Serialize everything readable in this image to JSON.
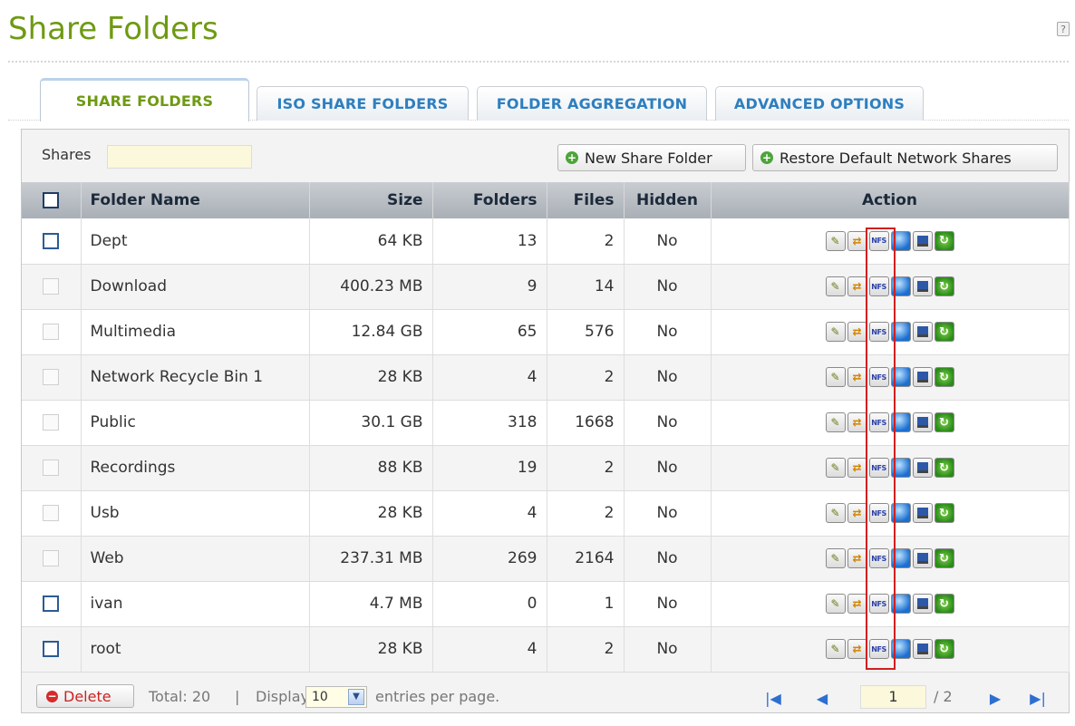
{
  "page": {
    "title": "Share Folders",
    "help": "?"
  },
  "tabs": [
    {
      "label": "SHARE FOLDERS",
      "active": true
    },
    {
      "label": "ISO SHARE FOLDERS",
      "active": false
    },
    {
      "label": "FOLDER AGGREGATION",
      "active": false
    },
    {
      "label": "ADVANCED OPTIONS",
      "active": false
    }
  ],
  "toolbar": {
    "shares_label": "Shares",
    "search_value": "",
    "new_share_label": "New Share Folder",
    "restore_label": "Restore Default Network Shares"
  },
  "table": {
    "headers": {
      "name": "Folder Name",
      "size": "Size",
      "folders": "Folders",
      "files": "Files",
      "hidden": "Hidden",
      "action": "Action"
    },
    "rows": [
      {
        "name": "Dept",
        "size": "64 KB",
        "folders": "13",
        "files": "2",
        "hidden": "No",
        "selectable": true
      },
      {
        "name": "Download",
        "size": "400.23 MB",
        "folders": "9",
        "files": "14",
        "hidden": "No",
        "selectable": false
      },
      {
        "name": "Multimedia",
        "size": "12.84 GB",
        "folders": "65",
        "files": "576",
        "hidden": "No",
        "selectable": false
      },
      {
        "name": "Network Recycle Bin 1",
        "size": "28 KB",
        "folders": "4",
        "files": "2",
        "hidden": "No",
        "selectable": false
      },
      {
        "name": "Public",
        "size": "30.1 GB",
        "folders": "318",
        "files": "1668",
        "hidden": "No",
        "selectable": false
      },
      {
        "name": "Recordings",
        "size": "88 KB",
        "folders": "19",
        "files": "2",
        "hidden": "No",
        "selectable": false
      },
      {
        "name": "Usb",
        "size": "28 KB",
        "folders": "4",
        "files": "2",
        "hidden": "No",
        "selectable": false
      },
      {
        "name": "Web",
        "size": "237.31 MB",
        "folders": "269",
        "files": "2164",
        "hidden": "No",
        "selectable": false
      },
      {
        "name": "ivan",
        "size": "4.7 MB",
        "folders": "0",
        "files": "1",
        "hidden": "No",
        "selectable": true
      },
      {
        "name": "root",
        "size": "28 KB",
        "folders": "4",
        "files": "2",
        "hidden": "No",
        "selectable": true
      }
    ],
    "action_icons": [
      "edit-properties-icon",
      "access-permission-icon",
      "nfs-icon",
      "network-share-icon",
      "microsoft-networking-icon",
      "refresh-icon"
    ],
    "nfs_label": "NFS"
  },
  "footer": {
    "delete_label": "Delete",
    "total_text": "Total: 20",
    "separator": "|",
    "display_label": "Display",
    "per_page_value": "10",
    "entries_label": "entries per page.",
    "page_value": "1",
    "page_total": "/ 2"
  },
  "colors": {
    "title_green": "#6e9a12",
    "tab_blue": "#2e7fbf",
    "highlight_red": "#d21f1f"
  }
}
